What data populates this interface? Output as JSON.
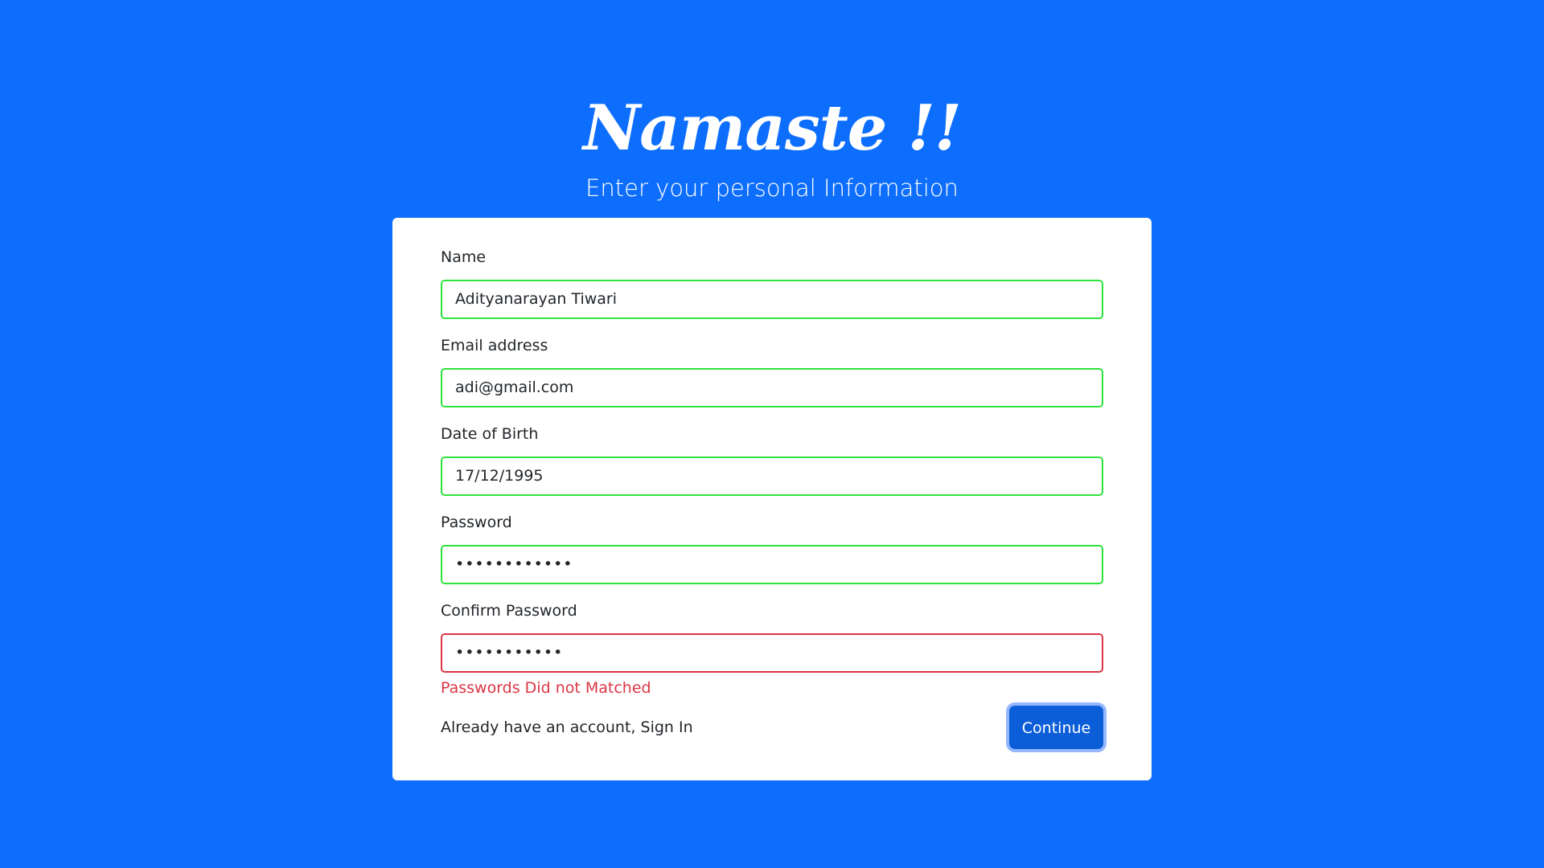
{
  "header": {
    "title": "Namaste !!",
    "subtitle": "Enter your personal Information"
  },
  "form": {
    "name": {
      "label": "Name",
      "value": "Adityanarayan Tiwari",
      "state": "valid"
    },
    "email": {
      "label": "Email address",
      "value": "adi@gmail.com",
      "state": "valid"
    },
    "dob": {
      "label": "Date of Birth",
      "value": "17/12/1995",
      "state": "valid"
    },
    "password": {
      "label": "Password",
      "value": "••••••••••••",
      "state": "valid"
    },
    "confirm_password": {
      "label": "Confirm Password",
      "value": "•••••••••••",
      "state": "invalid",
      "error": "Passwords Did not Matched"
    },
    "signin_text": "Already have an account, Sign In",
    "submit_label": "Continue"
  },
  "colors": {
    "background": "#0d6efd",
    "valid_border": "#2ee33e",
    "invalid_border": "#dc3545",
    "button": "#0b5ed7"
  }
}
